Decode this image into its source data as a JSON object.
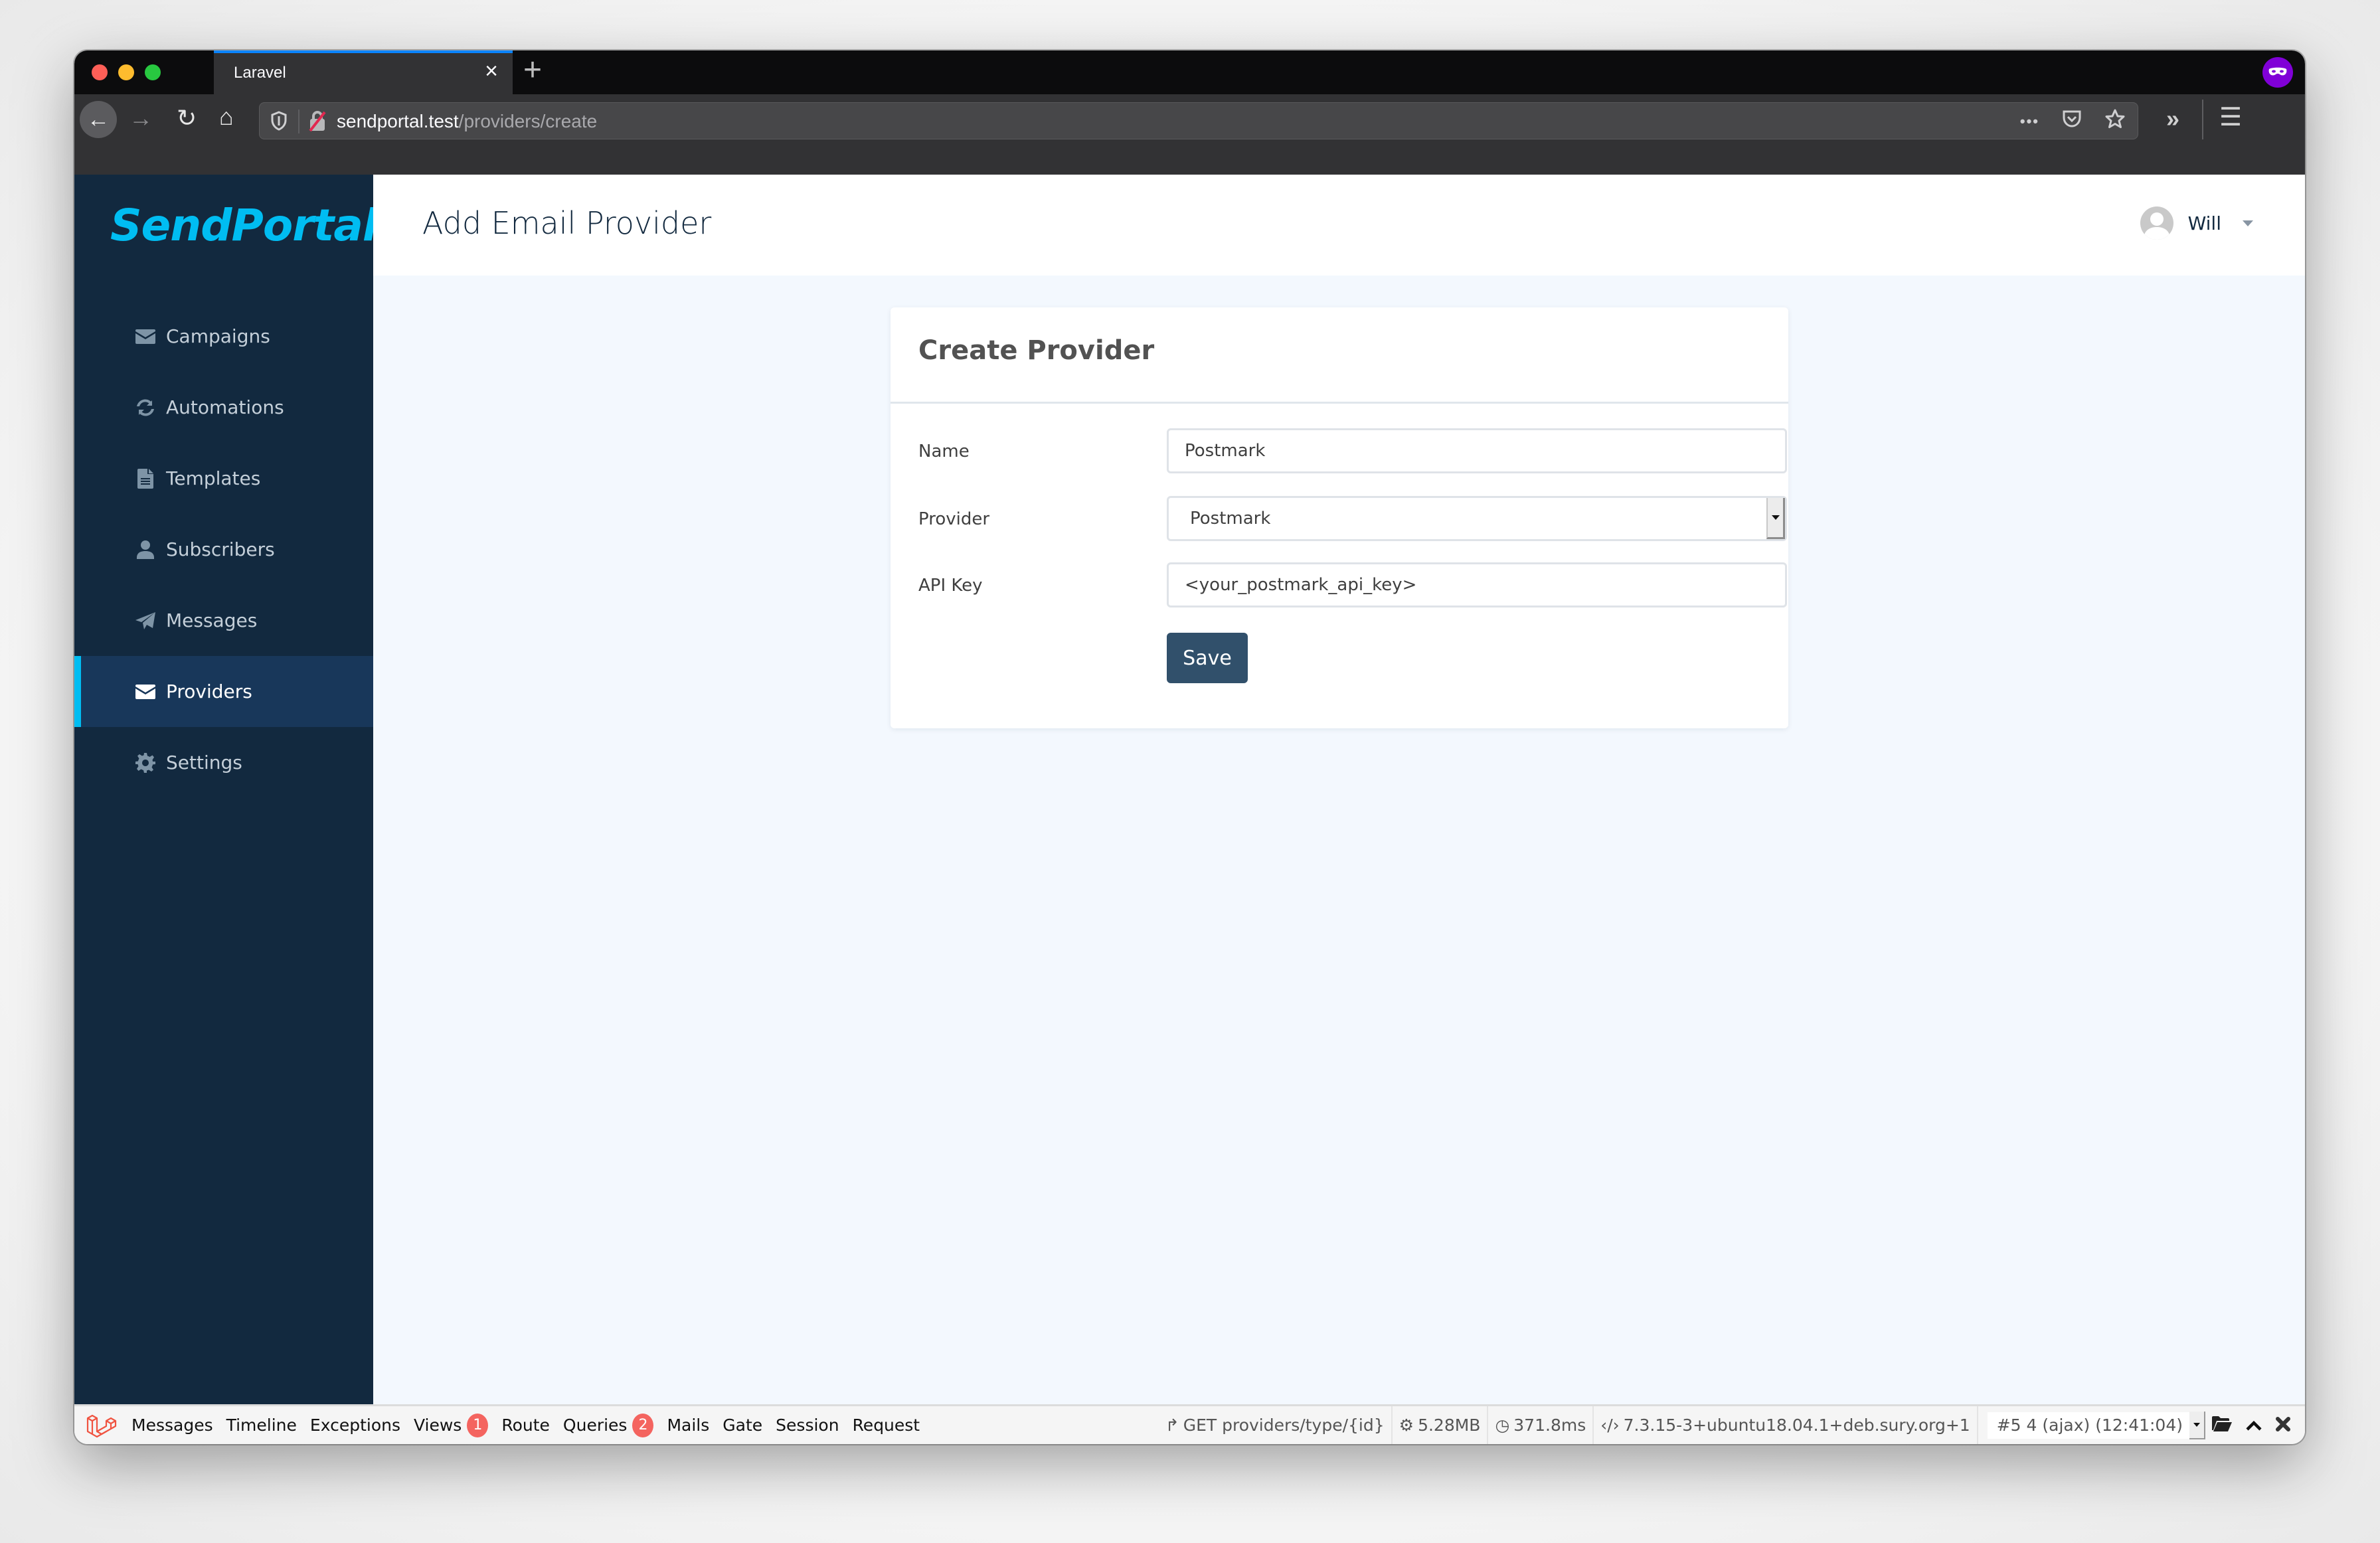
{
  "browser": {
    "tab_title": "Laravel",
    "tab_close": "×",
    "new_tab": "+",
    "url_host": "sendportal.test",
    "url_path": "/providers/create",
    "icons": {
      "back": "←",
      "forward": "→",
      "reload": "↻",
      "home": "⌂",
      "more": "•••",
      "overflow": "»",
      "menu": "☰",
      "star": "☆"
    }
  },
  "sidebar": {
    "brand": "SendPortal",
    "items": [
      {
        "label": "Campaigns",
        "icon": "envelope-icon",
        "active": false
      },
      {
        "label": "Automations",
        "icon": "sync-icon",
        "active": false
      },
      {
        "label": "Templates",
        "icon": "file-icon",
        "active": false
      },
      {
        "label": "Subscribers",
        "icon": "user-icon",
        "active": false
      },
      {
        "label": "Messages",
        "icon": "paper-plane-icon",
        "active": false
      },
      {
        "label": "Providers",
        "icon": "envelope-icon",
        "active": true
      },
      {
        "label": "Settings",
        "icon": "gear-icon",
        "active": false
      }
    ]
  },
  "header": {
    "title": "Add Email Provider",
    "user_name": "Will"
  },
  "card": {
    "title": "Create Provider",
    "fields": {
      "name": {
        "label": "Name",
        "value": "Postmark"
      },
      "provider": {
        "label": "Provider",
        "value": "Postmark"
      },
      "api_key": {
        "label": "API Key",
        "value": "<your_postmark_api_key>"
      }
    },
    "save_label": "Save"
  },
  "debugbar": {
    "tabs": [
      {
        "label": "Messages"
      },
      {
        "label": "Timeline"
      },
      {
        "label": "Exceptions"
      },
      {
        "label": "Views",
        "badge": "1"
      },
      {
        "label": "Route"
      },
      {
        "label": "Queries",
        "badge": "2"
      },
      {
        "label": "Mails"
      },
      {
        "label": "Gate"
      },
      {
        "label": "Session"
      },
      {
        "label": "Request"
      }
    ],
    "route": "GET providers/type/{id}",
    "memory": "5.28MB",
    "time": "371.8ms",
    "php_version": "7.3.15-3+ubuntu18.04.1+deb.sury.org+1",
    "request_select": "#5 4 (ajax) (12:41:04)"
  },
  "colors": {
    "sidebar_bg": "#12293f",
    "brand": "#00bdf2",
    "active_item_bg": "#18375a",
    "save_button": "#31506b",
    "badge": "#f4645f",
    "main_bg": "#f3f8fe"
  }
}
